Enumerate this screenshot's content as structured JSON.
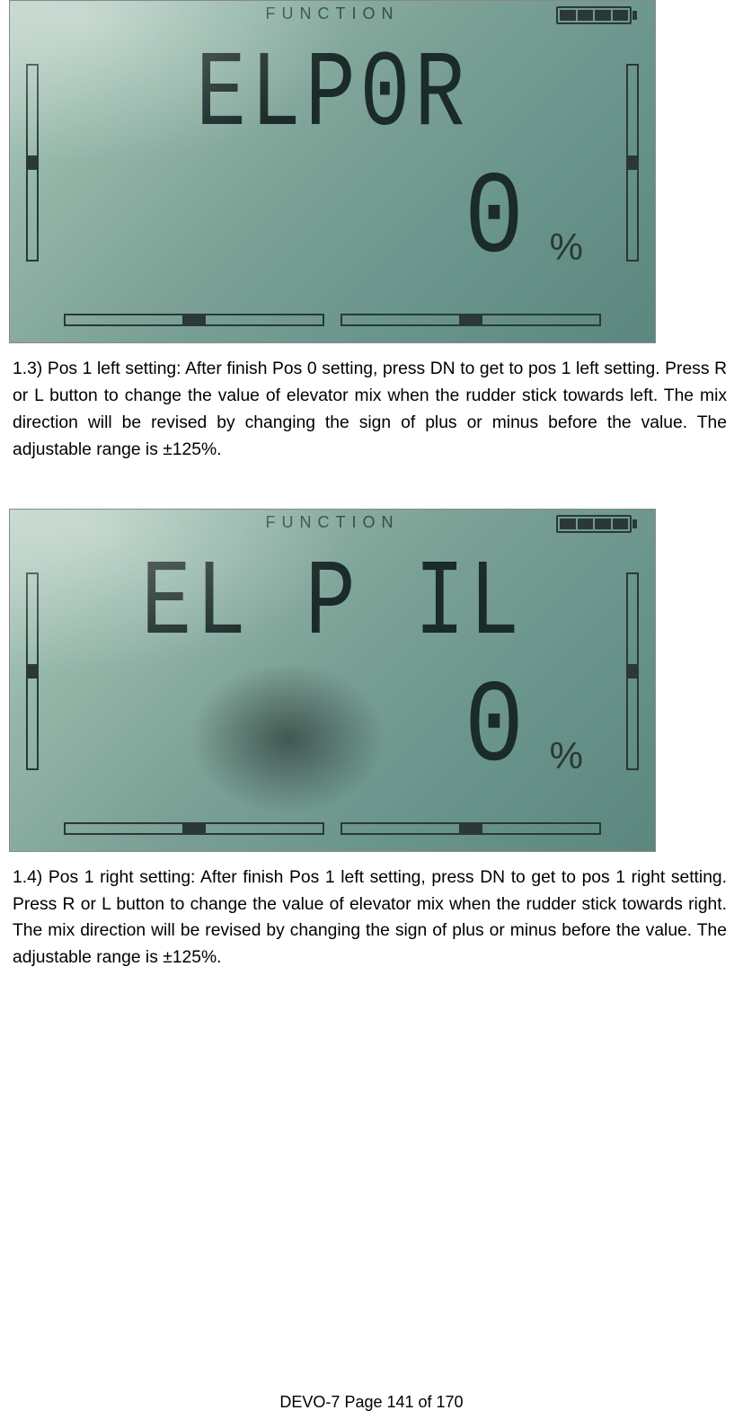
{
  "lcd1": {
    "func_label": "FUNCTION",
    "line1": "ELP0R",
    "value": "0",
    "unit": "%"
  },
  "para1": "1.3) Pos 1 left setting: After finish Pos 0 setting, press DN to get to pos 1 left setting. Press R or L button to change the value of elevator mix when the rudder stick towards left. The mix direction will be revised by changing the sign of plus or minus before the value. The adjustable range is ±125%.",
  "lcd2": {
    "func_label": "FUNCTION",
    "line1": "EL P IL",
    "value": "0",
    "unit": "%"
  },
  "para2": "1.4) Pos 1 right setting: After finish Pos 1 left setting, press DN to get to pos 1 right setting. Press R or L button to change the value of elevator mix when the rudder stick towards right. The mix direction will be revised by changing the sign of plus or minus before the value. The adjustable range is ±125%.",
  "footer": "DEVO-7   Page 141 of 170"
}
